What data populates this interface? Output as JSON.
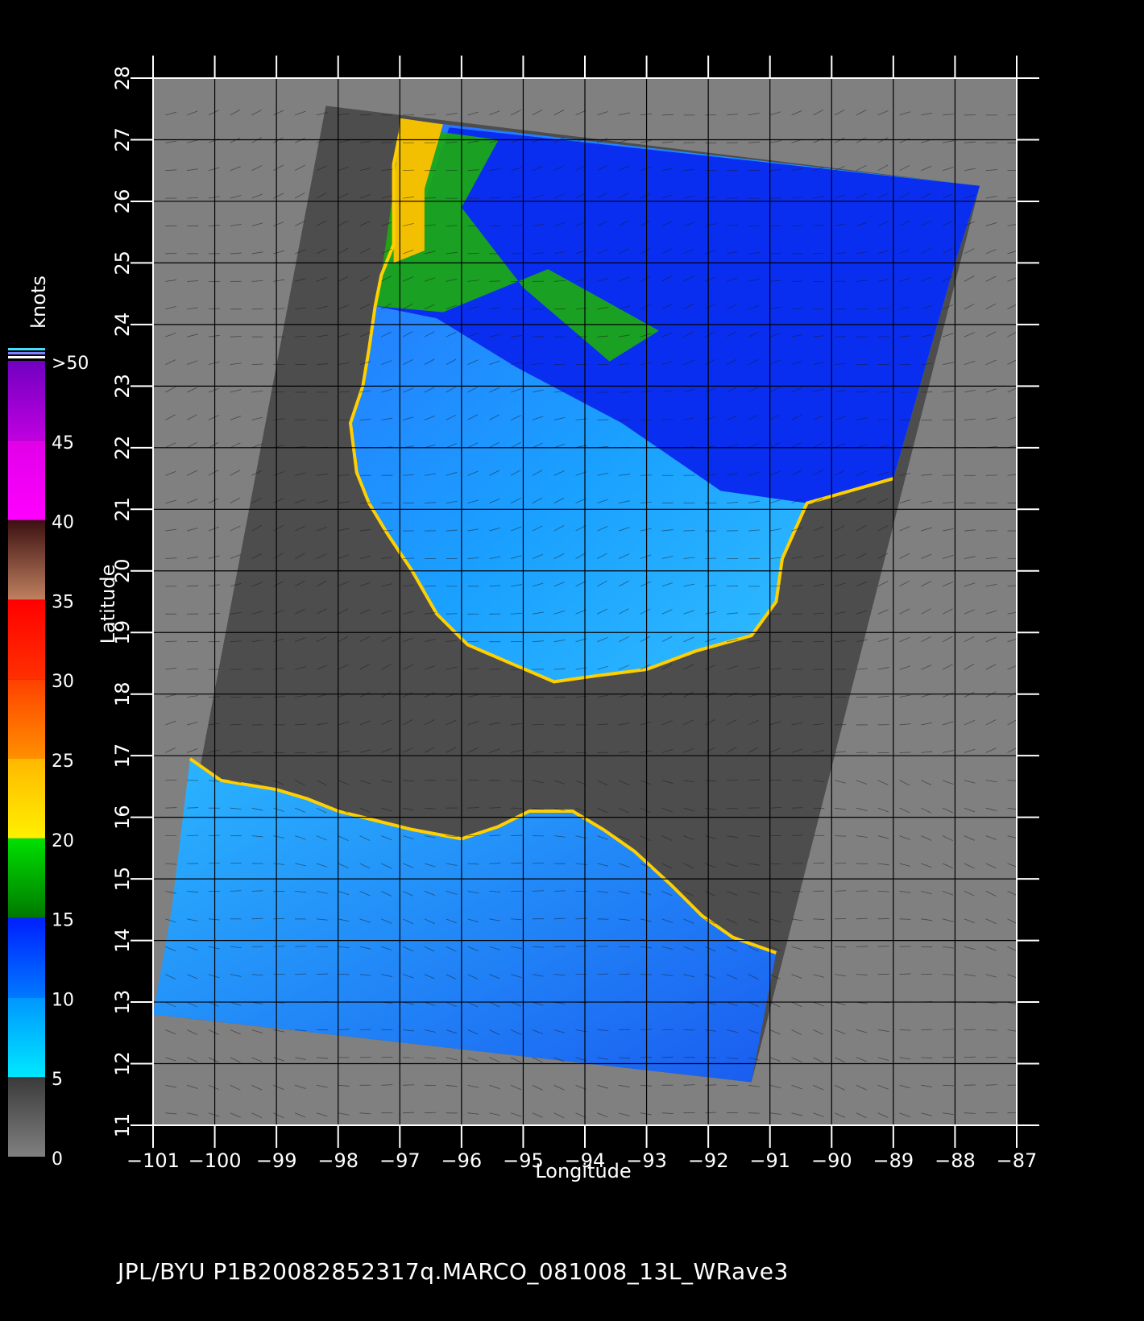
{
  "map": {
    "x_axis": {
      "label": "Longitude",
      "range": [
        -101,
        -87
      ],
      "ticks": [
        -101,
        -100,
        -99,
        -98,
        -97,
        -96,
        -95,
        -94,
        -93,
        -92,
        -91,
        -90,
        -89,
        -88,
        -87
      ]
    },
    "y_axis": {
      "label": "Latitude",
      "range": [
        11,
        28
      ],
      "ticks": [
        11,
        12,
        13,
        14,
        15,
        16,
        17,
        18,
        19,
        20,
        21,
        22,
        23,
        24,
        25,
        26,
        27,
        28
      ]
    },
    "grid": true,
    "colors": {
      "background": "#000000",
      "land": "#4d4d4d",
      "outside_swath": "#808080",
      "grid": "#000000",
      "frame": "#ffffff"
    }
  },
  "colorbar": {
    "title": "knots",
    "labels": [
      "0",
      "5",
      "10",
      "15",
      "20",
      "25",
      "30",
      "35",
      "40",
      "45",
      ">50"
    ],
    "segments": [
      {
        "from": 0,
        "to": 5,
        "top": "#3a3a3a",
        "bottom": "#808080"
      },
      {
        "from": 5,
        "to": 10,
        "top": "#0096ff",
        "bottom": "#00e8ff"
      },
      {
        "from": 10,
        "to": 15,
        "top": "#0020ff",
        "bottom": "#0078ff"
      },
      {
        "from": 15,
        "to": 20,
        "top": "#00e000",
        "bottom": "#007800"
      },
      {
        "from": 20,
        "to": 25,
        "top": "#ffb800",
        "bottom": "#fff000"
      },
      {
        "from": 25,
        "to": 30,
        "top": "#ff4000",
        "bottom": "#ff9000"
      },
      {
        "from": 30,
        "to": 35,
        "top": "#ff0000",
        "bottom": "#ff3000"
      },
      {
        "from": 35,
        "to": 40,
        "top": "#3a1010",
        "bottom": "#c08060"
      },
      {
        "from": 40,
        "to": 45,
        "top": "#e000e8",
        "bottom": "#ff00ff"
      },
      {
        "from": 45,
        "to": 50,
        "top": "#7000c0",
        "bottom": "#c000e0"
      }
    ]
  },
  "footer": {
    "text": "JPL/BYU  P1B20082852317q.MARCO_081008_13L_WRave3"
  }
}
